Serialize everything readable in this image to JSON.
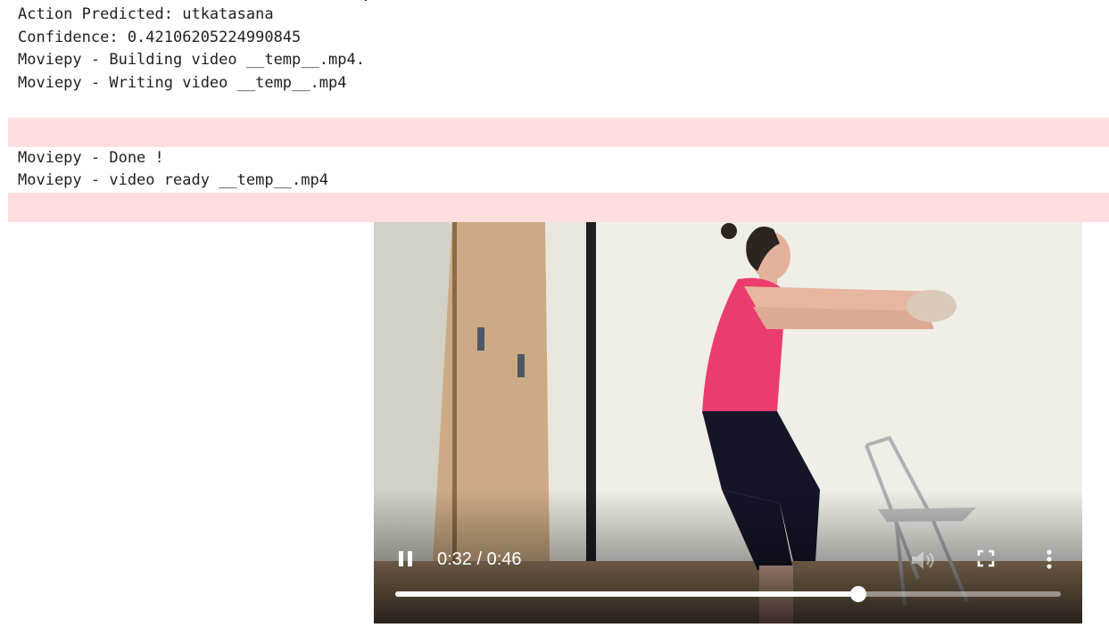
{
  "output": {
    "partial_line": ".",
    "lines_top": [
      "Action Predicted: utkatasana",
      "Confidence: 0.42106205224990845",
      "Moviepy - Building video __temp__.mp4.",
      "Moviepy - Writing video __temp__.mp4"
    ],
    "lines_bottom": [
      "Moviepy - Done !",
      "Moviepy - video ready __temp__.mp4"
    ]
  },
  "video": {
    "time_display": "0:32 / 0:46",
    "progress": 0.696,
    "icons": {
      "play_state": "pause-icon",
      "volume": "volume-muted-icon",
      "fullscreen": "fullscreen-icon",
      "menu": "more-vert-icon"
    }
  },
  "colors": {
    "stderr_background": "#fedddd",
    "text": "#212121"
  }
}
